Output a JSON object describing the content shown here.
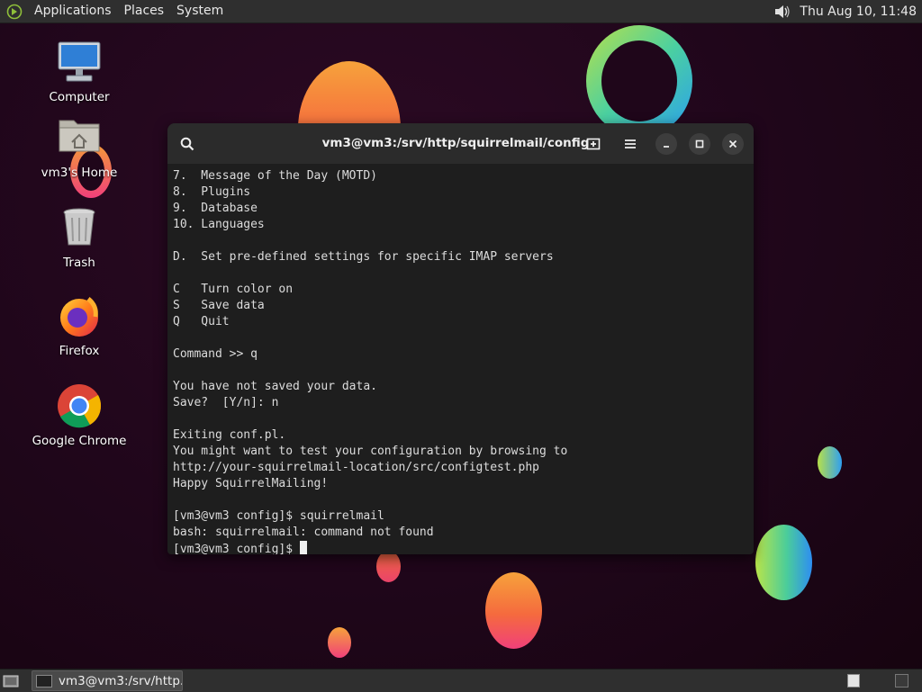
{
  "top_panel": {
    "menus": [
      "Applications",
      "Places",
      "System"
    ],
    "clock": "Thu Aug 10, 11:48",
    "volume_icon": "volume-icon"
  },
  "desktop": {
    "icons": [
      {
        "label": "Computer",
        "icon": "computer-icon"
      },
      {
        "label": "vm3's Home",
        "icon": "home-folder-icon"
      },
      {
        "label": "Trash",
        "icon": "trash-icon"
      },
      {
        "label": "Firefox",
        "icon": "firefox-icon"
      },
      {
        "label": "Google Chrome",
        "icon": "chrome-icon"
      }
    ]
  },
  "terminal": {
    "title": "vm3@vm3:/srv/http/squirrelmail/config",
    "lines": [
      "7.  Message of the Day (MOTD)",
      "8.  Plugins",
      "9.  Database",
      "10. Languages",
      "",
      "D.  Set pre-defined settings for specific IMAP servers",
      "",
      "C   Turn color on",
      "S   Save data",
      "Q   Quit",
      "",
      "Command >> q",
      "",
      "You have not saved your data.",
      "Save?  [Y/n]: n",
      "",
      "Exiting conf.pl.",
      "You might want to test your configuration by browsing to",
      "http://your-squirrelmail-location/src/configtest.php",
      "Happy SquirrelMailing!",
      "",
      "[vm3@vm3 config]$ squirrelmail",
      "bash: squirrelmail: command not found"
    ],
    "prompt": "[vm3@vm3 config]$ "
  },
  "taskbar": {
    "task_label": "vm3@vm3:/srv/http..."
  },
  "colors": {
    "panel": "#2f2f2f",
    "terminal_bg": "#1e1e1e",
    "terminal_header": "#2b2b2b",
    "desktop_bg": "#1f061a"
  }
}
